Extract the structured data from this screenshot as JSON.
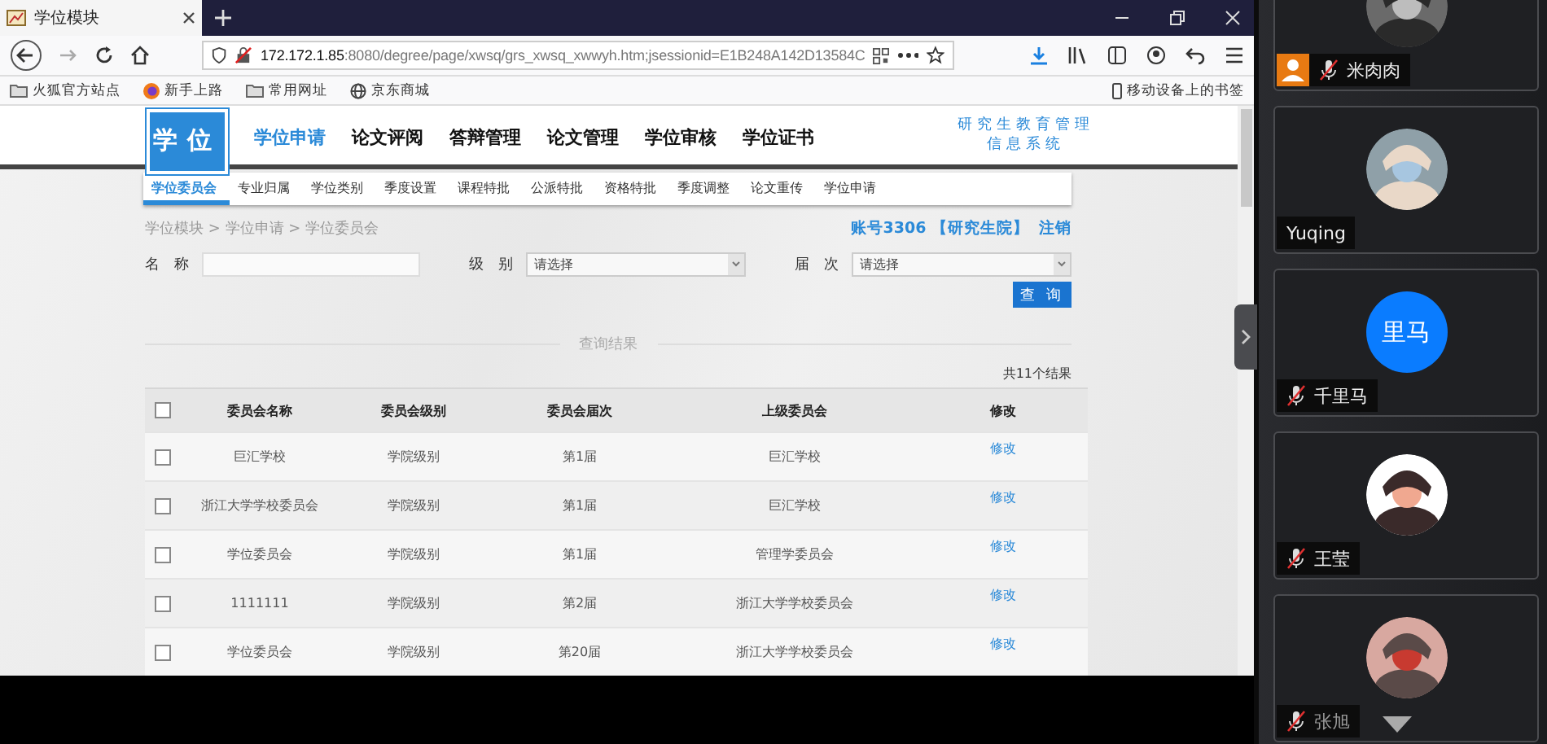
{
  "browser": {
    "tab_title": "学位模块",
    "url_host": "172.172.1.85",
    "url_rest": ":8080/degree/page/xwsq/grs_xwsq_xwwyh.htm;jsessionid=E1B248A142D13584C",
    "bookmarks": [
      {
        "label": "火狐官方站点",
        "kind": "folder"
      },
      {
        "label": "新手上路",
        "kind": "firefox"
      },
      {
        "label": "常用网址",
        "kind": "folder"
      },
      {
        "label": "京东商城",
        "kind": "globe"
      }
    ],
    "mobile_bookmarks": "移动设备上的书签"
  },
  "site": {
    "logo": "学位",
    "nav": [
      {
        "label": "学位申请",
        "selected": true
      },
      {
        "label": "论文评阅",
        "selected": false
      },
      {
        "label": "答辩管理",
        "selected": false
      },
      {
        "label": "论文管理",
        "selected": false
      },
      {
        "label": "学位审核",
        "selected": false
      },
      {
        "label": "学位证书",
        "selected": false
      }
    ],
    "system_name": [
      "研究生教育管理",
      "信息系统"
    ],
    "subnav": [
      {
        "label": "学位委员会",
        "selected": true
      },
      {
        "label": "专业归属",
        "selected": false
      },
      {
        "label": "学位类别",
        "selected": false
      },
      {
        "label": "季度设置",
        "selected": false
      },
      {
        "label": "课程特批",
        "selected": false
      },
      {
        "label": "公派特批",
        "selected": false
      },
      {
        "label": "资格特批",
        "selected": false
      },
      {
        "label": "季度调整",
        "selected": false
      },
      {
        "label": "论文重传",
        "selected": false
      },
      {
        "label": "学位申请",
        "selected": false
      }
    ],
    "breadcrumb": "学位模块 > 学位申请 > 学位委员会",
    "account": "账号3306 【研究生院】",
    "logout": "注销",
    "filters": [
      {
        "label": "名　称",
        "kind": "text"
      },
      {
        "label": "级　别",
        "kind": "select",
        "placeholder": "请选择"
      },
      {
        "label": "届　次",
        "kind": "select",
        "placeholder": "请选择"
      }
    ],
    "query_button": "查 询",
    "results_title": "查询结果",
    "results_count": "共11个结果",
    "table": {
      "select_all_checked": false,
      "columns": [
        "委员会名称",
        "委员会级别",
        "委员会届次",
        "上级委员会",
        "修改"
      ],
      "rows": [
        {
          "checked": false,
          "cells": [
            "巨汇学校",
            "学院级别",
            "第1届",
            "巨汇学校"
          ],
          "action": "修改"
        },
        {
          "checked": false,
          "cells": [
            "浙江大学学校委员会",
            "学院级别",
            "第1届",
            "巨汇学校"
          ],
          "action": "修改"
        },
        {
          "checked": false,
          "cells": [
            "学位委员会",
            "学院级别",
            "第1届",
            "管理学委员会"
          ],
          "action": "修改"
        },
        {
          "checked": false,
          "cells": [
            "1111111",
            "学院级别",
            "第2届",
            "浙江大学学校委员会"
          ],
          "action": "修改"
        },
        {
          "checked": false,
          "cells": [
            "学位委员会",
            "学院级别",
            "第20届",
            "浙江大学学校委员会"
          ],
          "action": "修改"
        }
      ]
    }
  },
  "participants": [
    {
      "name": "米肉肉",
      "muted": true,
      "host": true
    },
    {
      "name": "Yuqing",
      "host": false
    },
    {
      "name": "千里马",
      "avatar": {
        "kind": "initials",
        "text": "里马",
        "color": "#0a7cff"
      },
      "muted": true,
      "host": false
    },
    {
      "name": "王莹",
      "muted": true,
      "host": false
    },
    {
      "name": "张旭",
      "muted": true,
      "host": false
    }
  ]
}
